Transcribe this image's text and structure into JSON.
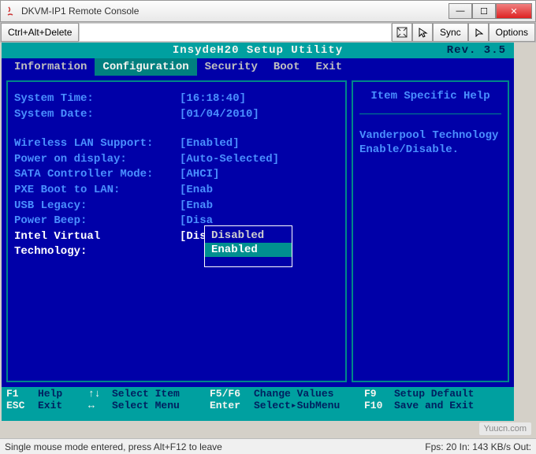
{
  "window": {
    "title": "DKVM-IP1 Remote Console",
    "min_tooltip": "Minimize",
    "max_tooltip": "Maximize",
    "close_tooltip": "Close"
  },
  "toolbar": {
    "cad_label": "Ctrl+Alt+Delete",
    "sync_label": "Sync",
    "options_label": "Options"
  },
  "bios": {
    "header_title": "InsydeH20 Setup Utility",
    "rev": "Rev. 3.5",
    "tabs": [
      "Information",
      "Configuration",
      "Security",
      "Boot",
      "Exit"
    ],
    "selected_tab": "Configuration",
    "rows": [
      {
        "label": "System Time:",
        "value": "[16:18:40]"
      },
      {
        "label": "System Date:",
        "value": "[01/04/2010]"
      },
      {
        "label": "Wireless LAN Support:",
        "value": "[Enabled]"
      },
      {
        "label": "Power on display:",
        "value": "[Auto-Selected]"
      },
      {
        "label": "SATA Controller Mode:",
        "value": "[AHCI]"
      },
      {
        "label": "PXE Boot to LAN:",
        "value": "[Enab"
      },
      {
        "label": "USB Legacy:",
        "value": "[Enab"
      },
      {
        "label": "Power Beep:",
        "value": "[Disa"
      },
      {
        "label": "Intel Virtual Technology:",
        "value": "[Disa"
      }
    ],
    "popup": {
      "options": [
        "Disabled",
        "Enabled"
      ],
      "selected": "Enabled"
    },
    "help": {
      "title": "Item Specific Help",
      "text_line1": "Vanderpool Technology",
      "text_line2": "Enable/Disable."
    },
    "footer": {
      "r1": {
        "k1": "F1",
        "l1": "Help",
        "k2": "↑↓",
        "l2": "Select Item",
        "k3": "F5/F6",
        "l3": "Change Values",
        "k4": "F9",
        "l4": "Setup Default"
      },
      "r2": {
        "k1": "ESC",
        "l1": "Exit",
        "k2": "↔",
        "l2": "Select Menu",
        "k3": "Enter",
        "l3": "Select▸SubMenu",
        "k4": "F10",
        "l4": "Save and Exit"
      }
    }
  },
  "status": {
    "left": "Single mouse mode entered, press Alt+F12 to leave",
    "right": "Fps: 20 In: 143 KB/s Out:"
  },
  "watermark": "Yuucn.com"
}
